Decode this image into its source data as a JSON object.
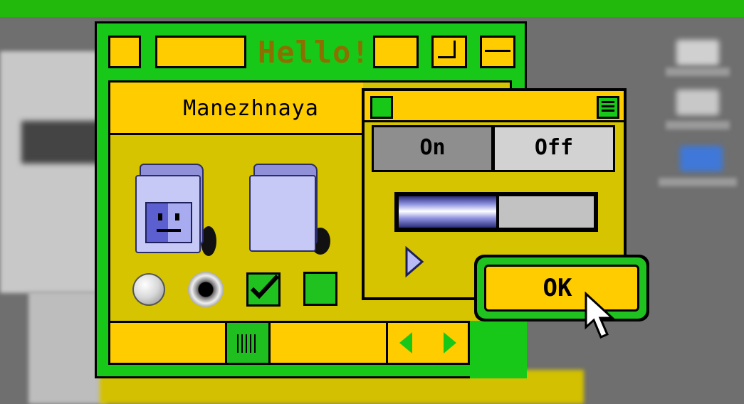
{
  "window": {
    "title": "Hello!"
  },
  "location": {
    "label": "Manezhnaya"
  },
  "folders": [
    {
      "icon": "system-folder-icon"
    },
    {
      "icon": "folder-icon"
    }
  ],
  "controls": {
    "radio_1_selected": false,
    "radio_2_selected": true,
    "checkbox_1_checked": true,
    "checkbox_2_checked": false
  },
  "panel": {
    "segmented": {
      "on_label": "On",
      "off_label": "Off",
      "selected": "On"
    },
    "progress": {
      "value": 0.5
    }
  },
  "ok_button": {
    "label": "OK"
  },
  "colors": {
    "window_green": "#18c818",
    "accent_yellow": "#ffcc00",
    "pane_olive": "#d6c400",
    "title_text": "#8a7000",
    "progress_blue": "#8f92e0"
  }
}
